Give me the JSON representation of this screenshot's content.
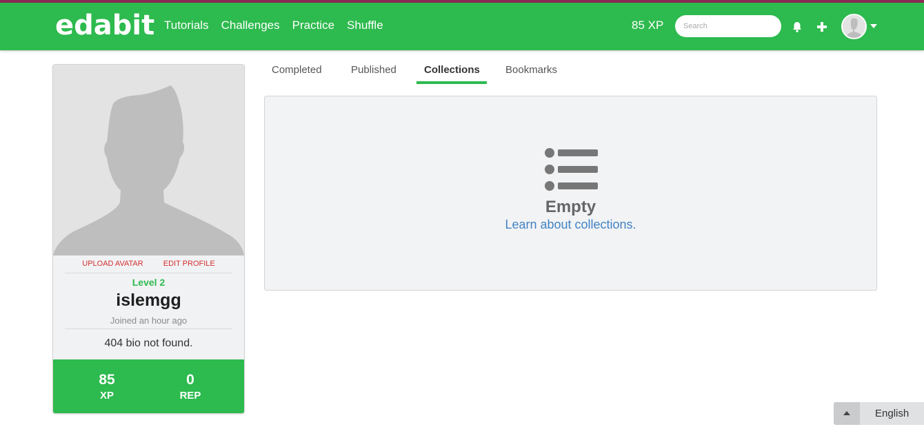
{
  "colors": {
    "brand_green": "#2dba4e",
    "top_stripe": "#8b2a55",
    "link_blue": "#4183c4",
    "action_red": "#d32f2f"
  },
  "navbar": {
    "logo": "edabit",
    "links": [
      "Tutorials",
      "Challenges",
      "Practice",
      "Shuffle"
    ],
    "xp": "85 XP",
    "search_placeholder": "Search",
    "icons": [
      "bell-icon",
      "plus-icon",
      "avatar",
      "chevron-down-icon"
    ]
  },
  "profile": {
    "upload_avatar": "UPLOAD AVATAR",
    "edit_profile": "EDIT PROFILE",
    "level": "Level 2",
    "username": "islemgg",
    "joined": "Joined an hour ago",
    "bio": "404 bio not found.",
    "stats": [
      {
        "value": "85",
        "label": "XP"
      },
      {
        "value": "0",
        "label": "REP"
      }
    ]
  },
  "tabs": [
    {
      "label": "Completed",
      "active": false
    },
    {
      "label": "Published",
      "active": false
    },
    {
      "label": "Collections",
      "active": true
    },
    {
      "label": "Bookmarks",
      "active": false
    }
  ],
  "panel": {
    "icon": "list-icon",
    "title": "Empty",
    "link": "Learn about collections."
  },
  "language": {
    "current": "English"
  }
}
